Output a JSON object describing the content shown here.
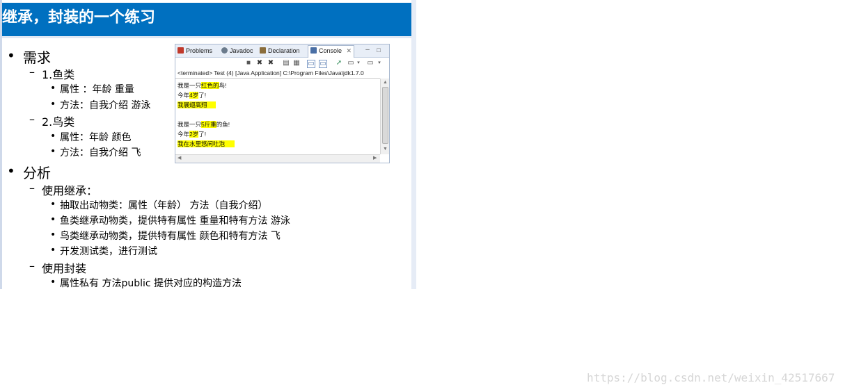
{
  "title": "继承，封装的一个练习",
  "outline": {
    "requirements": {
      "heading": "需求",
      "fish": {
        "heading": "1.鱼类",
        "attributes": "属性 ：年龄   重量",
        "methods": "方法：自我介绍   游泳"
      },
      "bird": {
        "heading": "2.鸟类",
        "attributes": "属性：年龄 颜色",
        "methods": "方法：自我介绍   飞"
      }
    },
    "analysis": {
      "heading": "分析",
      "inheritance": {
        "heading": "使用继承：",
        "items": [
          "抽取出动物类：属性（年龄）    方法（自我介绍）",
          "鱼类继承动物类，提供特有属性  重量和特有方法 游泳",
          "鸟类继承动物类，提供特有属性  颜色和特有方法  飞",
          "开发测试类，进行测试"
        ]
      },
      "encapsulation": {
        "heading": "使用封装",
        "items": [
          "属性私有   方法public 提供对应的构造方法"
        ]
      }
    }
  },
  "console_panel": {
    "tabs": [
      {
        "label": "Problems",
        "icon": "problems-icon",
        "color": "#c0392b"
      },
      {
        "label": "Javadoc",
        "icon": "javadoc-icon",
        "color": "#6b7b8c"
      },
      {
        "label": "Declaration",
        "icon": "declaration-icon",
        "color": "#8a6d3b"
      },
      {
        "label": "Console",
        "icon": "console-icon",
        "color": "#4a6fa5"
      }
    ],
    "status": "<terminated> Test (4) [Java Application] C:\\Program Files\\Java\\jdk1.7.0",
    "lines": [
      {
        "pre": "我是一只",
        "hl": "红色的",
        "post": "鸟!"
      },
      {
        "pre": "今年",
        "hl": "4岁",
        "post": "了!"
      },
      {
        "pre": "",
        "hl": "我展翅高翔",
        "post": ""
      },
      {
        "pre": "",
        "hl": "",
        "post": ""
      },
      {
        "pre": "我是一只",
        "hl": "5斤重",
        "post": "的鱼!"
      },
      {
        "pre": "今年",
        "hl": "2岁",
        "post": "了!"
      },
      {
        "pre": "",
        "hl": "我在水里悠闲吐泡",
        "post": ""
      }
    ],
    "highlight_color": "#ffff00"
  },
  "watermark": "https://blog.csdn.net/weixin_42517667",
  "colors": {
    "title_background": "#0070c0",
    "title_text": "#ffffff"
  }
}
